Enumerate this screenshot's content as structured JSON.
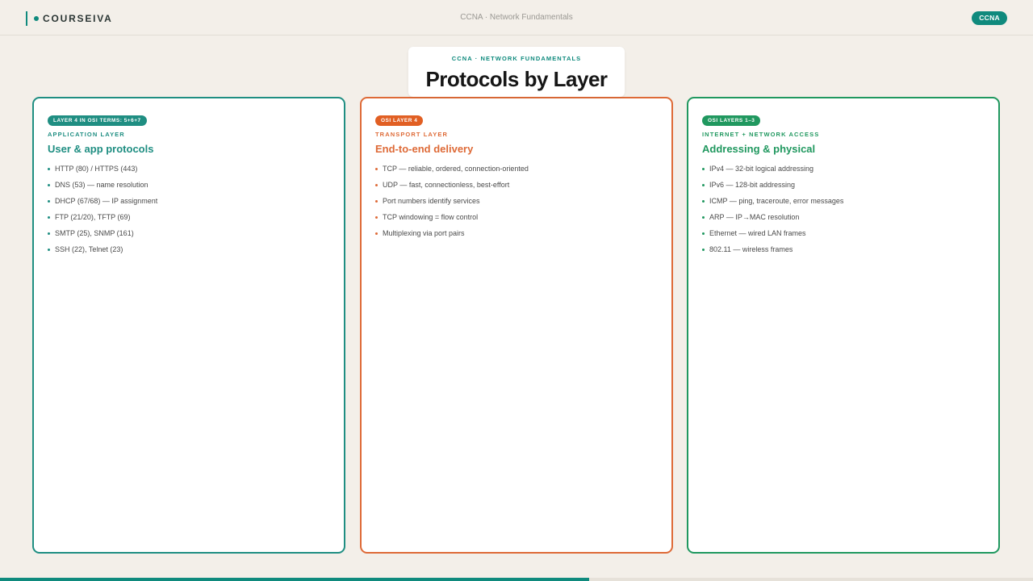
{
  "header": {
    "brand": "COURSEIVA",
    "title": "CCNA · Network Fundamentals",
    "badge": "CCNA"
  },
  "slide": {
    "kicker": "CCNA · NETWORK FUNDAMENTALS",
    "title": "Protocols by Layer"
  },
  "columns": [
    {
      "pill": "LAYER 4 IN OSI TERMS: 5+6+7",
      "kicker": "APPLICATION LAYER",
      "heading": "User & app protocols",
      "items": [
        "HTTP (80) / HTTPS (443)",
        "DNS (53) — name resolution",
        "DHCP (67/68) — IP assignment",
        "FTP (21/20), TFTP (69)",
        "SMTP (25), SNMP (161)",
        "SSH (22), Telnet (23)"
      ]
    },
    {
      "pill": "OSI LAYER 4",
      "kicker": "TRANSPORT LAYER",
      "heading": "End-to-end delivery",
      "items": [
        "TCP — reliable, ordered, connection-oriented",
        "UDP — fast, connectionless, best-effort",
        "Port numbers identify services",
        "TCP windowing = flow control",
        "Multiplexing via port pairs"
      ]
    },
    {
      "pill": "OSI LAYERS 1–3",
      "kicker": "INTERNET + NETWORK ACCESS",
      "heading": "Addressing & physical",
      "items": [
        "IPv4 — 32-bit logical addressing",
        "IPv6 — 128-bit addressing",
        "ICMP — ping, traceroute, error messages",
        "ARP — IP→MAC resolution",
        "Ethernet — wired LAN frames",
        "802.11 — wireless frames"
      ]
    }
  ],
  "progress": {
    "fraction": 0.57
  },
  "colors": {
    "teal": "#1f8e82",
    "orange": "#de6a37",
    "green": "#20985f",
    "background": "#f3efe9"
  }
}
